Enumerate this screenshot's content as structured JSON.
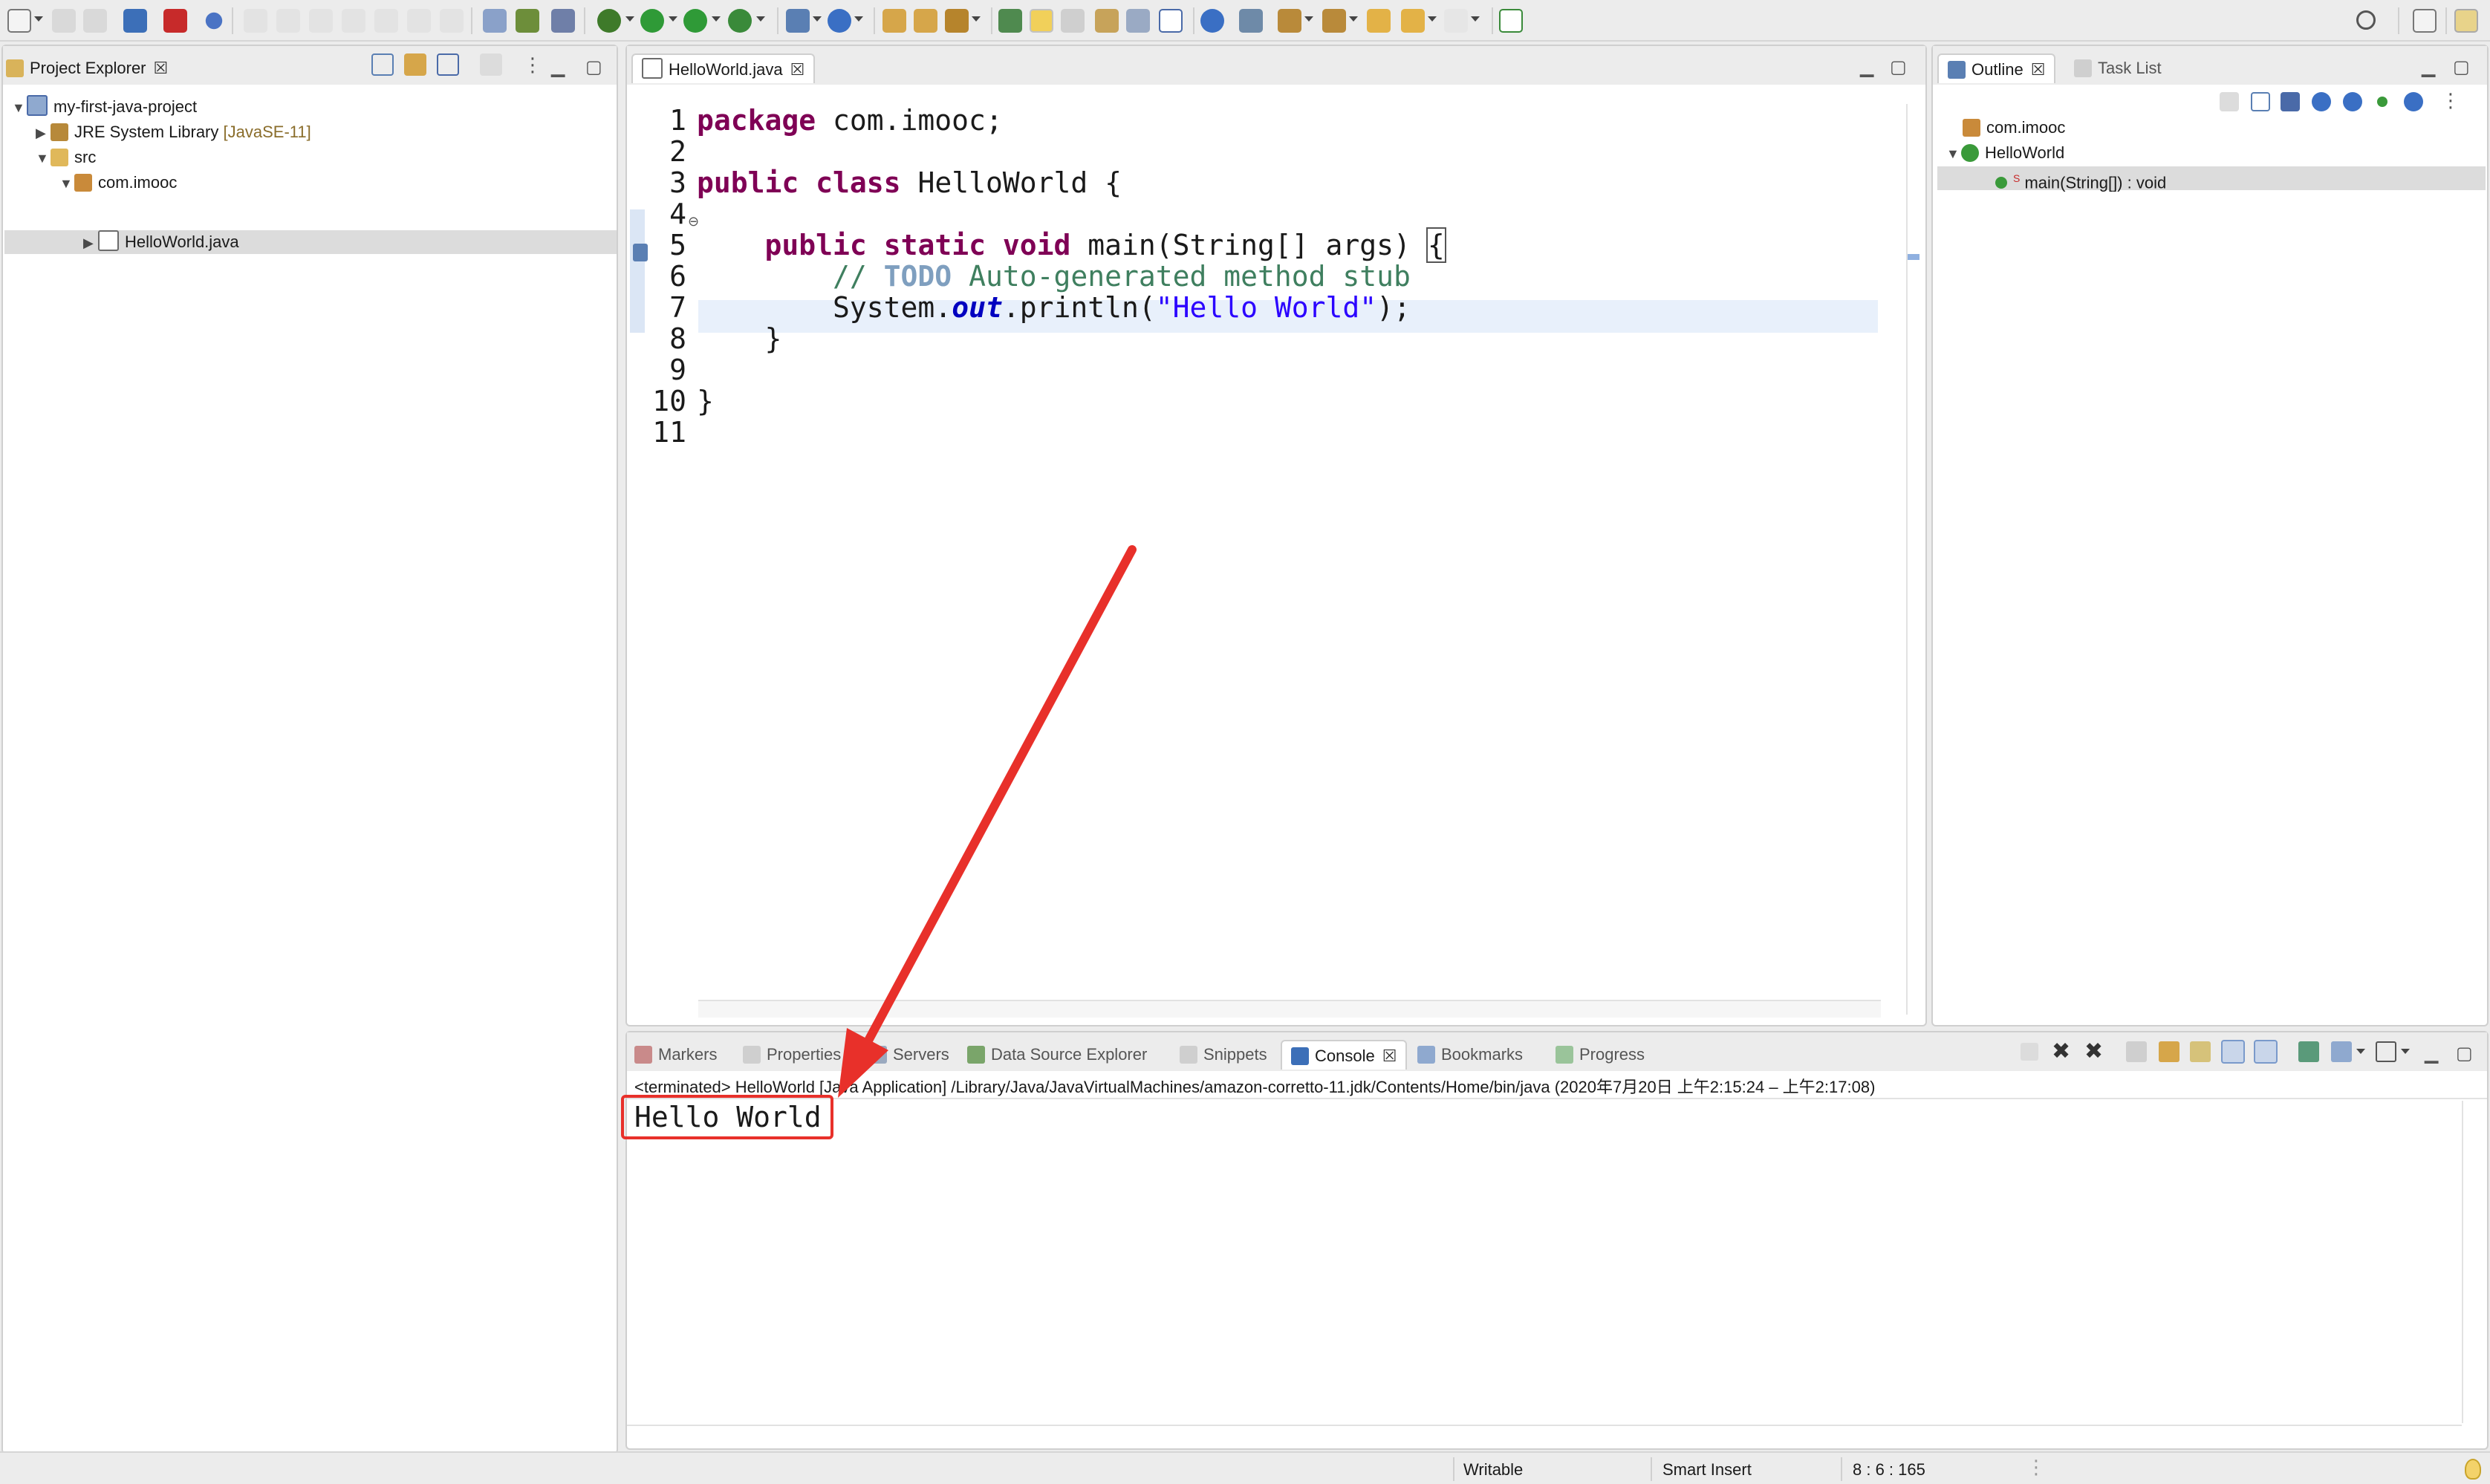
{
  "colors": {
    "keyword": "#7f0055",
    "comment": "#3f7f5f",
    "string": "#2a00ff",
    "field": "#0000c0",
    "annotation_red": "#e8302a",
    "selection": "#dcdcdc"
  },
  "project_explorer": {
    "tab_label": "Project Explorer",
    "tree": [
      {
        "label": "my-first-java-project",
        "icon": "java-project-icon"
      },
      {
        "label": "JRE System Library",
        "suffix": "[JavaSE-11]",
        "icon": "library-icon"
      },
      {
        "label": "src",
        "icon": "source-folder-icon"
      },
      {
        "label": "com.imooc",
        "icon": "package-icon"
      },
      {
        "label": "HelloWorld.java",
        "icon": "java-file-icon"
      }
    ]
  },
  "editor": {
    "tab_label": "HelloWorld.java",
    "line_numbers": [
      "1",
      "2",
      "3",
      "4",
      "5",
      "6",
      "7",
      "8",
      "9",
      "10",
      "11"
    ],
    "lines": {
      "l1_kw": "package",
      "l1_rest": " com.imooc;",
      "l3_kw1": "public",
      "l3_kw2": "class",
      "l3_rest": " HelloWorld {",
      "l5_indent": "    ",
      "l5_kw1": "public",
      "l5_kw2": "static",
      "l5_kw3": "void",
      "l5_rest": " main(String[] args) ",
      "l5_brace": "{",
      "l6_indent": "        ",
      "l6_c1": "// ",
      "l6_todo": "TODO",
      "l6_c2": " Auto-generated method stub",
      "l7_indent": "        ",
      "l7_a": "System.",
      "l7_out": "out",
      "l7_b": ".println(",
      "l7_str": "\"Hello World\"",
      "l7_c": ");",
      "l8": "    }",
      "l10": "}"
    }
  },
  "outline": {
    "tab_label": "Outline",
    "tab2_label": "Task List",
    "tree": [
      {
        "label": "com.imooc",
        "icon": "package-icon"
      },
      {
        "label": "HelloWorld",
        "icon": "class-icon"
      },
      {
        "label": "main(String[]) : void",
        "icon": "public-method-icon",
        "marker": "S"
      }
    ]
  },
  "bottom": {
    "tabs": [
      "Markers",
      "Properties",
      "Servers",
      "Data Source Explorer",
      "Snippets",
      "Console",
      "Bookmarks",
      "Progress"
    ],
    "active_tab": "Console",
    "console_header": "<terminated> HelloWorld [Java Application] /Library/Java/JavaVirtualMachines/amazon-corretto-11.jdk/Contents/Home/bin/java  (2020年7月20日 上午2:15:24 – 上午2:17:08)",
    "console_output": "Hello World"
  },
  "status": {
    "writable": "Writable",
    "insert_mode": "Smart Insert",
    "position": "8 : 6 : 165"
  }
}
